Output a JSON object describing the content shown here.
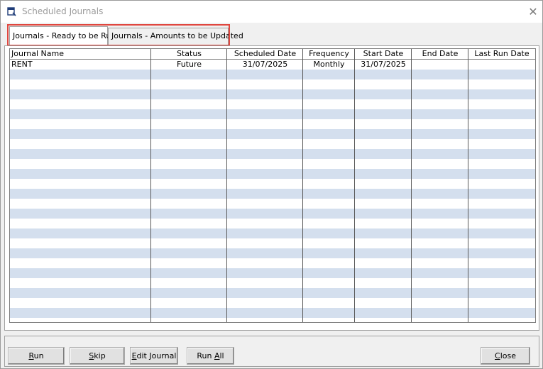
{
  "window": {
    "title": "Scheduled Journals",
    "close_glyph": "✕",
    "icon": "window-icon"
  },
  "tabs": [
    {
      "label": "Journals - Ready to be Run",
      "active": true
    },
    {
      "label": "Journals - Amounts to be Updated",
      "active": false
    }
  ],
  "table": {
    "columns": [
      "Journal Name",
      "Status",
      "Scheduled Date",
      "Frequency",
      "Start Date",
      "End Date",
      "Last Run Date"
    ],
    "rows": [
      [
        "RENT",
        "Future",
        "31/07/2025",
        "Monthly",
        "31/07/2025",
        "",
        ""
      ]
    ],
    "row_alt_color": "#d4dfee"
  },
  "buttons": {
    "run": {
      "mnemonic": "R",
      "rest": "un"
    },
    "skip": {
      "mnemonic": "S",
      "rest": "kip"
    },
    "edit_journal": {
      "mnemonic": "E",
      "rest": "dit Journal"
    },
    "run_all": {
      "pre": "Run ",
      "mnemonic": "A",
      "rest": "ll"
    },
    "close": {
      "mnemonic": "C",
      "rest": "lose"
    }
  },
  "accent": {
    "highlight": "#e0473f"
  }
}
